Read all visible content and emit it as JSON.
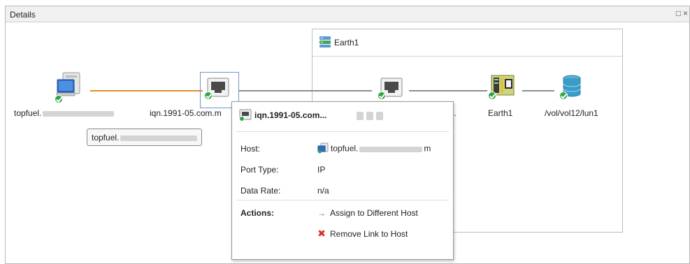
{
  "panel": {
    "title": "Details",
    "controls": {
      "restore": "□",
      "close": "×"
    }
  },
  "group": {
    "title": "Earth1",
    "icon": "host-group-icon"
  },
  "nodes": {
    "host": {
      "label": "topfuel.",
      "icon": "computer-icon"
    },
    "initiator_port": {
      "label": "iqn.1991-05.com.m",
      "icon": "network-port-icon"
    },
    "target_port": {
      "label": "..",
      "icon": "network-port-icon"
    },
    "storage_system": {
      "label": "Earth1",
      "icon": "storage-controller-icon"
    },
    "volume": {
      "label": "/vol/vol12/lun1",
      "icon": "database-icon"
    }
  },
  "hover_tooltip": {
    "text": "topfuel."
  },
  "popup": {
    "title": "iqn.1991-05.com...",
    "properties": [
      {
        "label": "Host:",
        "value": "topfuel.",
        "value_suffix": "m"
      },
      {
        "label": "Port Type:",
        "value": "IP"
      },
      {
        "label": "Data Rate:",
        "value": "n/a"
      }
    ],
    "actions_label": "Actions:",
    "actions": [
      {
        "label": "Assign to Different Host",
        "icon": "arrow-right-icon"
      },
      {
        "label": "Remove Link to Host",
        "icon": "red-x-icon"
      }
    ]
  },
  "colors": {
    "host_link": "#e08a2c",
    "storage_link": "#8e8e8e",
    "status_ok": "#2fa544",
    "selection": "#6f97c6",
    "action_arrow": "#3b6fd0",
    "action_remove": "#d93025"
  }
}
